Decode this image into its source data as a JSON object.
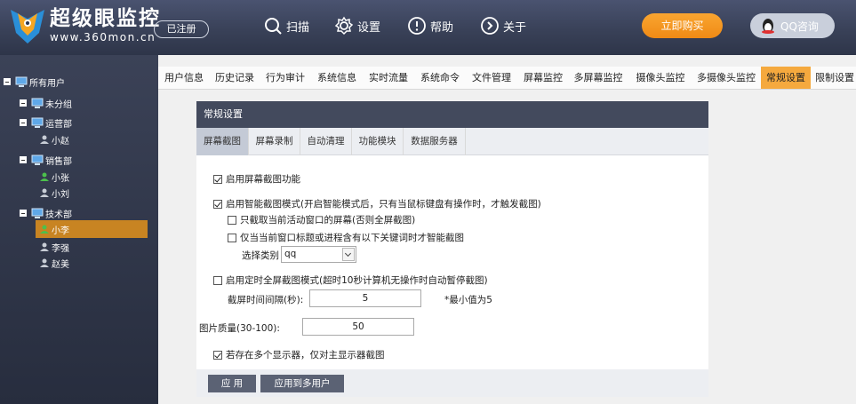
{
  "header": {
    "brand_title": "超级眼监控",
    "brand_sub": "www.360mon.cn",
    "registered": "已注册",
    "nav": [
      {
        "label": "扫描",
        "icon": "scan-icon"
      },
      {
        "label": "设置",
        "icon": "gear-icon"
      },
      {
        "label": "帮助",
        "icon": "help-icon"
      },
      {
        "label": "关于",
        "icon": "about-icon"
      }
    ],
    "buy": "立即购买",
    "qq": "QQ咨询"
  },
  "sidebar": {
    "root": "所有用户",
    "groups": [
      {
        "label": "未分组",
        "users": []
      },
      {
        "label": "运营部",
        "users": [
          "小赵"
        ]
      },
      {
        "label": "销售部",
        "users": [
          "小张",
          "小刘"
        ]
      },
      {
        "label": "技术部",
        "users": [
          "小李",
          "李强",
          "赵美"
        ]
      }
    ],
    "selected_user": "小李"
  },
  "tabs": [
    "用户信息",
    "历史记录",
    "行为审计",
    "系统信息",
    "实时流量",
    "系统命令",
    "文件管理",
    "屏幕监控",
    "多屏幕监控",
    "摄像头监控",
    "多摄像头监控",
    "常规设置",
    "限制设置"
  ],
  "active_tab": "常规设置",
  "panel": {
    "title": "常规设置",
    "subtabs": [
      "屏幕截图",
      "屏幕录制",
      "自动清理",
      "功能模块",
      "数据服务器"
    ],
    "active_subtab": "屏幕截图",
    "options": {
      "enable_capture": {
        "label": "启用屏幕截图功能",
        "checked": true
      },
      "smart_mode": {
        "label": "启用智能截图模式(开启智能模式后，只有当鼠标键盘有操作时，才触发截图)",
        "checked": true
      },
      "active_window_only": {
        "label": "只截取当前活动窗口的屏幕(否则全屏截图)",
        "checked": false
      },
      "keyword_only": {
        "label": "仅当当前窗口标题或进程含有以下关键词时才智能截图",
        "checked": false
      },
      "category_label": "选择类别",
      "category_value": "qq",
      "timed_mode": {
        "label": "启用定时全屏截图模式(超时10秒计算机无操作时自动暂停截图)",
        "checked": false
      },
      "interval_label": "截屏时间间隔(秒):",
      "interval_value": "5",
      "interval_hint": "*最小值为5",
      "quality_label": "图片质量(30-100):",
      "quality_value": "50",
      "multi_monitor": {
        "label": "若存在多个显示器，仅对主显示器截图",
        "checked": true
      }
    },
    "buttons": {
      "apply": "应 用",
      "apply_multi": "应用到多用户"
    }
  }
}
